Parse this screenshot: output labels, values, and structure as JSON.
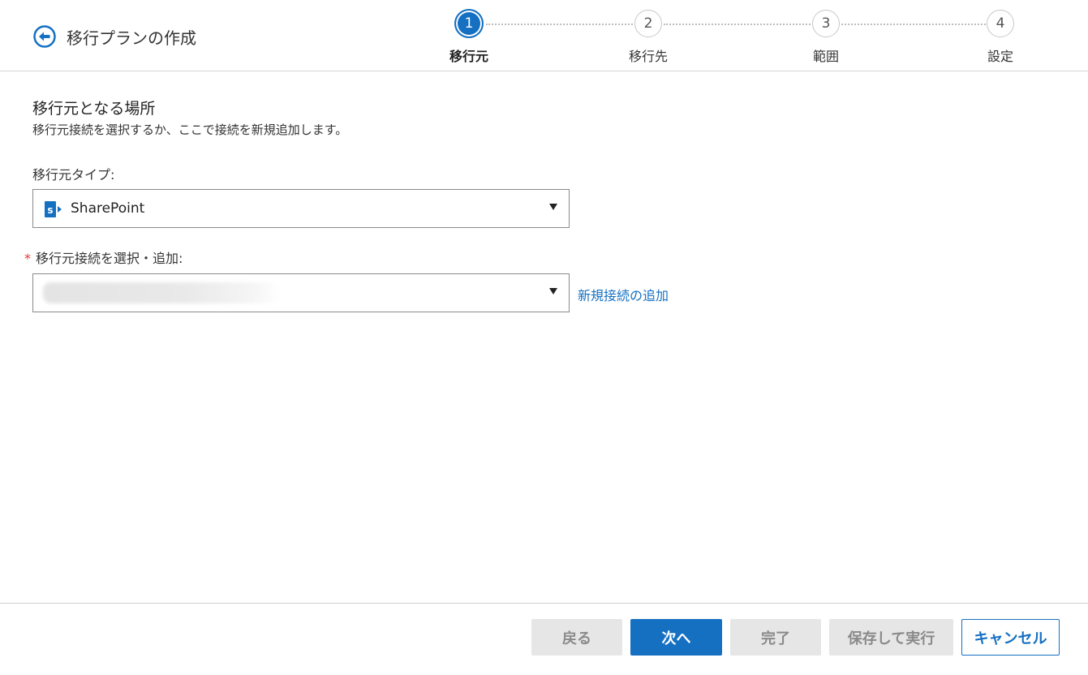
{
  "header": {
    "title": "移行プランの作成"
  },
  "stepper": {
    "steps": [
      {
        "number": "1",
        "label": "移行元",
        "active": true
      },
      {
        "number": "2",
        "label": "移行先",
        "active": false
      },
      {
        "number": "3",
        "label": "範囲",
        "active": false
      },
      {
        "number": "4",
        "label": "設定",
        "active": false
      }
    ]
  },
  "section": {
    "title": "移行元となる場所",
    "description": "移行元接続を選択するか、ここで接続を新規追加します。"
  },
  "source_type": {
    "label": "移行元タイプ:",
    "value": "SharePoint",
    "icon": "sharepoint-icon"
  },
  "connection": {
    "required_mark": "*",
    "label": "移行元接続を選択・追加:",
    "add_link": "新規接続の追加"
  },
  "footer": {
    "back_label": "戻る",
    "next_label": "次へ",
    "finish_label": "完了",
    "save_run_label": "保存して実行",
    "cancel_label": "キャンセル"
  },
  "colors": {
    "accent": "#1570c2",
    "required": "#e53935",
    "disabled_bg": "#e6e6e6"
  }
}
